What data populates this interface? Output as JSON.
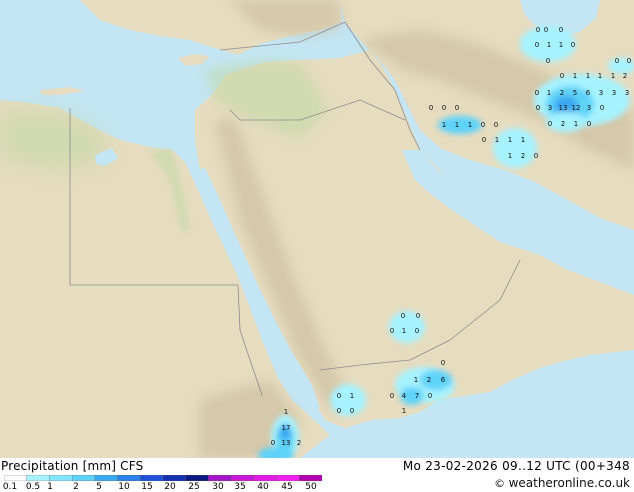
{
  "legend": {
    "title": "Precipitation [mm]  CFS",
    "ticks": [
      "0.1",
      "0.5",
      "1",
      "2",
      "5",
      "10",
      "15",
      "20",
      "25",
      "30",
      "35",
      "40",
      "45",
      "50"
    ],
    "colors": [
      "#ffffff",
      "#a6f2ff",
      "#82e4ff",
      "#5ed2f8",
      "#3aa8f0",
      "#2b7fe8",
      "#1f52d8",
      "#1530b0",
      "#0d1a84",
      "#a414c8",
      "#c818d8",
      "#e01ce4",
      "#f020f0",
      "#b000b0"
    ]
  },
  "datetime": "Mo 23-02-2026 09..12 UTC (00+348",
  "copyright": "weatheronline.co.uk",
  "colors": {
    "sea": "#c4e6f4",
    "land": "#e6dcc0",
    "mountains": "#c8b898",
    "green": "#c0d8a4",
    "borders": "#8c8c8c",
    "precip_light": "#a6f2ff",
    "precip_mid": "#5ed2f8",
    "precip_heavy": "#3aa8f0"
  },
  "precip_labels": [
    {
      "t": "0"
    },
    {
      "t": "0"
    },
    {
      "t": "0"
    },
    {
      "t": "0"
    },
    {
      "t": "1"
    },
    {
      "t": "1"
    },
    {
      "t": "0"
    },
    {
      "t": "0"
    },
    {
      "t": "0"
    },
    {
      "t": "0"
    },
    {
      "t": "0"
    },
    {
      "t": "1"
    },
    {
      "t": "1"
    },
    {
      "t": "1"
    },
    {
      "t": "1"
    },
    {
      "t": "2"
    },
    {
      "t": "0"
    },
    {
      "t": "1"
    },
    {
      "t": "2"
    },
    {
      "t": "5"
    },
    {
      "t": "6"
    },
    {
      "t": "3"
    },
    {
      "t": "3"
    },
    {
      "t": "3"
    },
    {
      "t": "0"
    },
    {
      "t": "3"
    },
    {
      "t": "13"
    },
    {
      "t": "12"
    },
    {
      "t": "3"
    },
    {
      "t": "0"
    },
    {
      "t": "0"
    },
    {
      "t": "2"
    },
    {
      "t": "1"
    },
    {
      "t": "0"
    },
    {
      "t": "0"
    },
    {
      "t": "0"
    },
    {
      "t": "0"
    },
    {
      "t": "1"
    },
    {
      "t": "1"
    },
    {
      "t": "1"
    },
    {
      "t": "0"
    },
    {
      "t": "0"
    },
    {
      "t": "0"
    },
    {
      "t": "1"
    },
    {
      "t": "1"
    },
    {
      "t": "1"
    },
    {
      "t": "1"
    },
    {
      "t": "2"
    },
    {
      "t": "0"
    },
    {
      "t": "0"
    },
    {
      "t": "0"
    },
    {
      "t": "0"
    },
    {
      "t": "1"
    },
    {
      "t": "0"
    },
    {
      "t": "0"
    },
    {
      "t": "1"
    },
    {
      "t": "2"
    },
    {
      "t": "6"
    },
    {
      "t": "0"
    },
    {
      "t": "4"
    },
    {
      "t": "7"
    },
    {
      "t": "0"
    },
    {
      "t": "1"
    },
    {
      "t": "0"
    },
    {
      "t": "1"
    },
    {
      "t": "0"
    },
    {
      "t": "0"
    },
    {
      "t": "1"
    },
    {
      "t": "17"
    },
    {
      "t": "0"
    },
    {
      "t": "13"
    },
    {
      "t": "2"
    }
  ]
}
